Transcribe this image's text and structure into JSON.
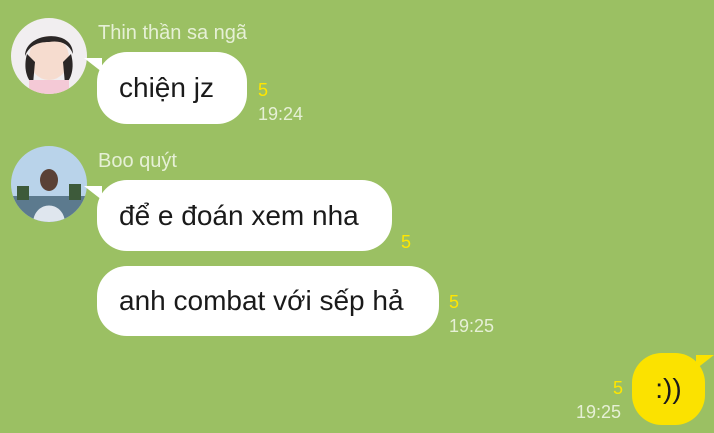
{
  "messages": [
    {
      "sender": "Thin thần sa ngã",
      "text": "chiện jz",
      "read_count": "5",
      "time": "19:24"
    },
    {
      "sender": "Boo quýt",
      "text": "để e đoán xem nha",
      "read_count": "5"
    },
    {
      "text": "anh combat với sếp hả",
      "read_count": "5",
      "time": "19:25"
    },
    {
      "text": ":))",
      "read_count": "5",
      "time": "19:25",
      "mine": true
    }
  ],
  "colors": {
    "background": "#9bc063",
    "incoming_bubble": "#ffffff",
    "outgoing_bubble": "#fbe200",
    "read_count": "#ffe600"
  }
}
